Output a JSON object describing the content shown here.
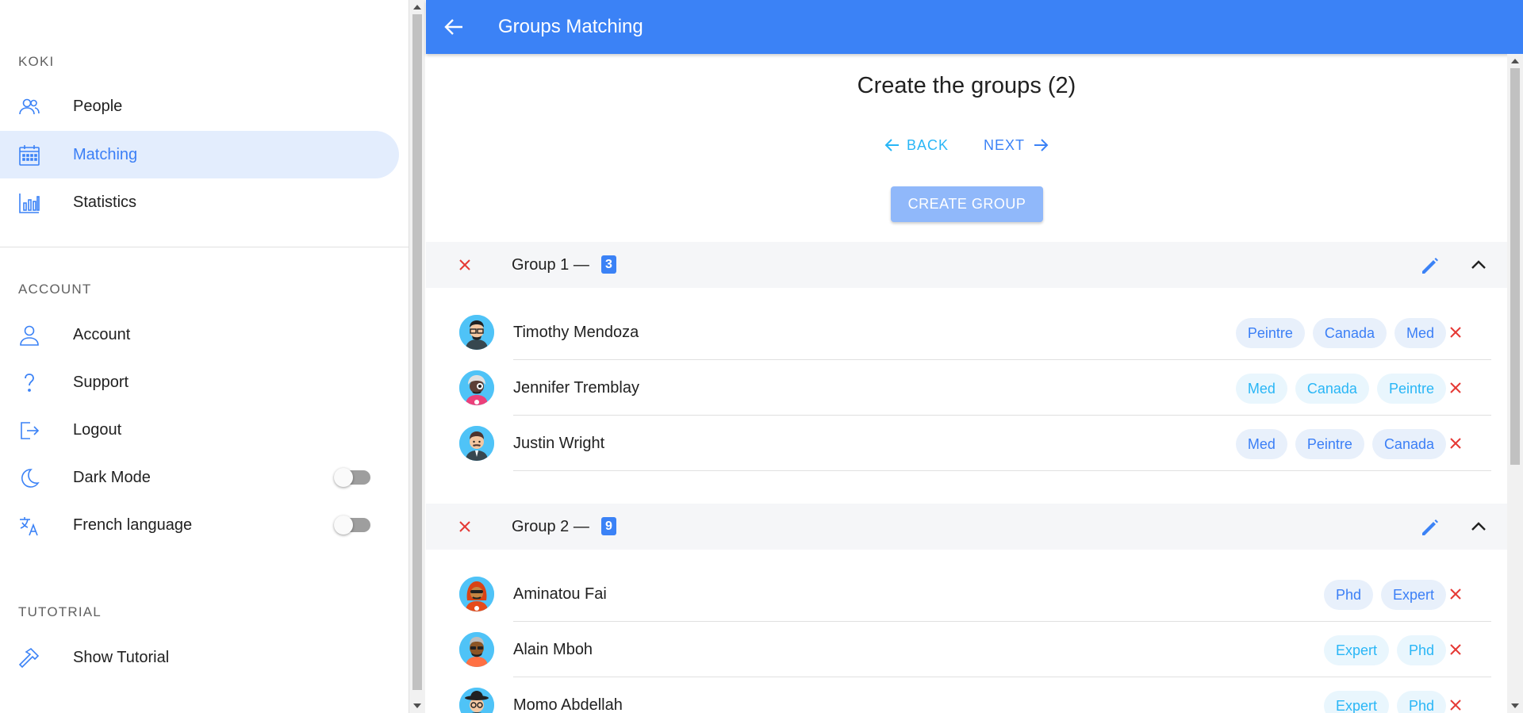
{
  "sidebar": {
    "sections": {
      "koki": "KOKI",
      "account": "ACCOUNT",
      "tutorial": "TUTOTRIAL"
    },
    "items": [
      {
        "label": "People",
        "icon": "people-icon"
      },
      {
        "label": "Matching",
        "icon": "calendar-icon",
        "active": true
      },
      {
        "label": "Statistics",
        "icon": "bar-chart-icon"
      },
      {
        "label": "Account",
        "icon": "user-icon"
      },
      {
        "label": "Support",
        "icon": "question-icon"
      },
      {
        "label": "Logout",
        "icon": "logout-icon"
      },
      {
        "label": "Dark Mode",
        "icon": "moon-icon",
        "toggle": false
      },
      {
        "label": "French language",
        "icon": "translate-icon",
        "toggle": false
      },
      {
        "label": "Show Tutorial",
        "icon": "hammer-icon"
      }
    ]
  },
  "appbar": {
    "title": "Groups Matching"
  },
  "page": {
    "heading": "Create the groups (2)",
    "back_label": "BACK",
    "next_label": "NEXT",
    "create_label": "CREATE GROUP"
  },
  "groups": [
    {
      "title": "Group 1 —",
      "count": "3",
      "members": [
        {
          "name": "Timothy Mendoza",
          "tags": [
            "Peintre",
            "Canada",
            "Med"
          ]
        },
        {
          "name": "Jennifer Tremblay",
          "tags": [
            "Med",
            "Canada",
            "Peintre"
          ]
        },
        {
          "name": "Justin Wright",
          "tags": [
            "Med",
            "Peintre",
            "Canada"
          ]
        }
      ]
    },
    {
      "title": "Group 2 —",
      "count": "9",
      "members": [
        {
          "name": "Aminatou Fai",
          "tags": [
            "Phd",
            "Expert"
          ]
        },
        {
          "name": "Alain Mboh",
          "tags": [
            "Expert",
            "Phd"
          ]
        },
        {
          "name": "Momo Abdellah",
          "tags": [
            "Expert",
            "Phd"
          ]
        }
      ]
    }
  ],
  "colors": {
    "primary": "#3b82f6",
    "danger": "#e53935",
    "active_bg": "#e3edfd"
  }
}
